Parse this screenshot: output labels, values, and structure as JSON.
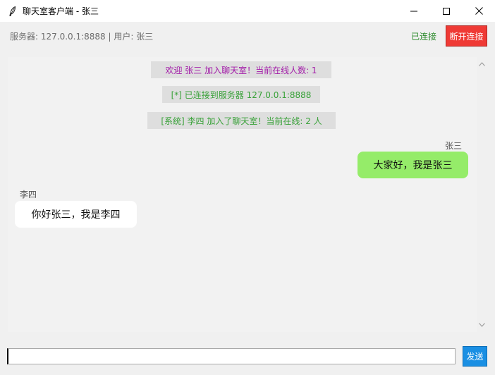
{
  "window": {
    "title": "聊天室客户端 - 张三",
    "icon": "feather-icon"
  },
  "status": {
    "server_info": "服务器: 127.0.0.1:8888 | 用户: 张三",
    "connection": "已连接",
    "disconnect_label": "断开连接",
    "connection_color": "#2b8a2b",
    "disconnect_color": "#ef3a35"
  },
  "messages": {
    "system": [
      {
        "text": "欢迎 张三 加入聊天室！当前在线人数: 1",
        "color": "#a21aa8"
      },
      {
        "text": "[*] 已连接到服务器 127.0.0.1:8888",
        "color": "#38a138"
      },
      {
        "text": "[系统] 李四 加入了聊天室！当前在线: 2 人",
        "color": "#38a138"
      }
    ],
    "chat": [
      {
        "sender": "张三",
        "text": "大家好，我是张三",
        "self": true,
        "bubble_color": "#95ec69"
      },
      {
        "sender": "李四",
        "text": "你好张三，我是李四",
        "self": false,
        "bubble_color": "#ffffff"
      }
    ]
  },
  "input": {
    "value": "",
    "send_label": "发送",
    "send_color": "#1a8fe3"
  }
}
